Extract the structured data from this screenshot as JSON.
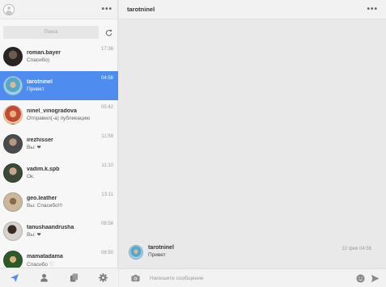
{
  "sidebar": {
    "menu_dots": "•••",
    "search_placeholder": "Поиск",
    "chats": [
      {
        "name": "roman.bayer",
        "message": "Спасибо)",
        "time": "17:36",
        "active": false
      },
      {
        "name": "tarotninel",
        "message": "Привет",
        "time": "04:56",
        "active": true
      },
      {
        "name": "ninel_vinogradova",
        "message": "Отправил(-а) публикацию",
        "time": "05:42",
        "active": false
      },
      {
        "name": "irezhisser",
        "message_prefix": "Вы:",
        "message_icon": "heart-icon",
        "time": "11:59",
        "active": false
      },
      {
        "name": "vadim.k.spb",
        "message": "Ок.",
        "time": "11:10",
        "active": false
      },
      {
        "name": "geo.leather",
        "message": "Вы: Спасибо!!!",
        "time": "13:11",
        "active": false
      },
      {
        "name": "tanushaandrusha",
        "message_prefix": "Вы:",
        "message_icon": "heart-icon",
        "time": "08:58",
        "active": false
      },
      {
        "name": "mamatadama",
        "message_prefix": "Спасибо",
        "message_icon": "heart-outline-icon",
        "time": "08:50",
        "active": false
      }
    ],
    "nav_icons": [
      "send-icon",
      "profile-icon",
      "copy-icon",
      "settings-icon"
    ]
  },
  "conversation": {
    "title": "tarotninel",
    "menu_dots": "•••",
    "message": {
      "author": "tarotninel",
      "text": "Привет",
      "time": "22 фев 04:56"
    },
    "composer_placeholder": "Напишите сообщение"
  },
  "colors": {
    "accent": "#4e8cf0",
    "icon": "#4e8cf0",
    "nav_icon": "#7a7a7a"
  }
}
